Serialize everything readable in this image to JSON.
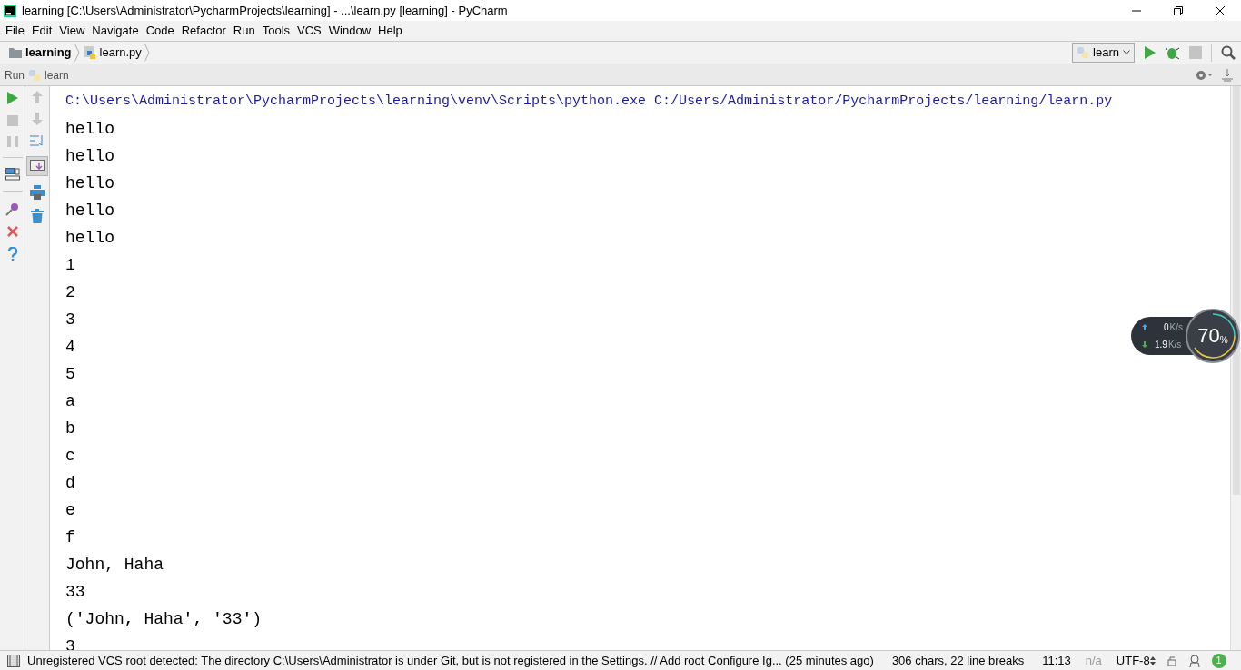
{
  "window": {
    "title": "learning [C:\\Users\\Administrator\\PycharmProjects\\learning] - ...\\learn.py [learning] - PyCharm"
  },
  "menu": [
    "File",
    "Edit",
    "View",
    "Navigate",
    "Code",
    "Refactor",
    "Run",
    "Tools",
    "VCS",
    "Window",
    "Help"
  ],
  "breadcrumbs": [
    {
      "label": "learning",
      "kind": "folder"
    },
    {
      "label": "learn.py",
      "kind": "file"
    }
  ],
  "run_config": "learn",
  "run_panel": {
    "label": "Run",
    "config": "learn"
  },
  "console": {
    "lines": [
      "C:\\Users\\Administrator\\PycharmProjects\\learning\\venv\\Scripts\\python.exe C:/Users/Administrator/PycharmProjects/learning/learn.py",
      "hello",
      "hello",
      "hello",
      "hello",
      "hello",
      "1",
      "2",
      "3",
      "4",
      "5",
      "a",
      "b",
      "c",
      "d",
      "e",
      "f",
      "John, Haha",
      "33",
      "('John, Haha', '33')",
      "3"
    ]
  },
  "net_widget": {
    "up": "0",
    "up_unit": "K/s",
    "down": "1.9",
    "down_unit": "K/s",
    "percent": "70",
    "percent_sign": "%"
  },
  "status_bar": {
    "message": "Unregistered VCS root detected: The directory C:\\Users\\Administrator is under Git, but is not registered in the Settings. // Add root  Configure  Ig... (25 minutes ago)",
    "chars": "306 chars, 22 line breaks",
    "position": "11:13",
    "na": "n/a",
    "encoding": "UTF-8",
    "notifications": "1"
  }
}
